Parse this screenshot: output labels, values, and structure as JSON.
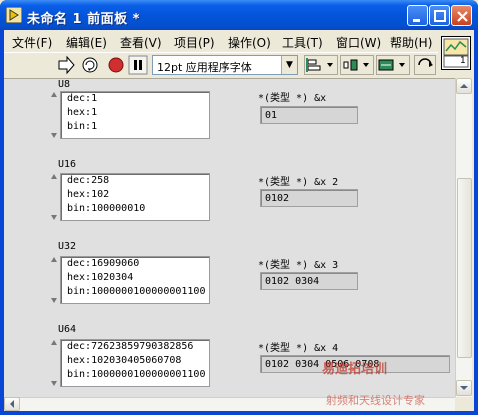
{
  "window": {
    "title": "未命名 1 前面板 *"
  },
  "menu": [
    "文件(F)",
    "编辑(E)",
    "查看(V)",
    "项目(P)",
    "操作(O)",
    "工具(T)",
    "窗口(W)",
    "帮助(H)"
  ],
  "toolbar": {
    "font": "12pt 应用程序字体"
  },
  "vi_icon": {
    "number": "1"
  },
  "rows": [
    {
      "label": "U8",
      "lines": [
        "dec:1",
        "hex:1",
        "bin:1"
      ],
      "ind_label": "*(类型 *) &x",
      "ind_value": "01"
    },
    {
      "label": "U16",
      "lines": [
        "dec:258",
        "hex:102",
        "bin:100000010"
      ],
      "ind_label": "*(类型 *) &x 2",
      "ind_value": "0102"
    },
    {
      "label": "U32",
      "lines": [
        "dec:16909060",
        "hex:1020304",
        "bin:1000000100000001100"
      ],
      "ind_label": "*(类型 *) &x 3",
      "ind_value": "0102 0304"
    },
    {
      "label": "U64",
      "lines": [
        "dec:72623859790382856",
        "hex:102030405060708",
        "bin:1000000100000001100"
      ],
      "ind_label": "*(类型 *) &x 4",
      "ind_value": "0102 0304 0506 0708"
    }
  ],
  "watermark": {
    "text": "易迪拓培训",
    "sub": "射频和天线设计专家"
  },
  "colors": {
    "titlebar": "#0453d8",
    "panel": "#e0e0e0",
    "accent": "#d12f2f"
  }
}
